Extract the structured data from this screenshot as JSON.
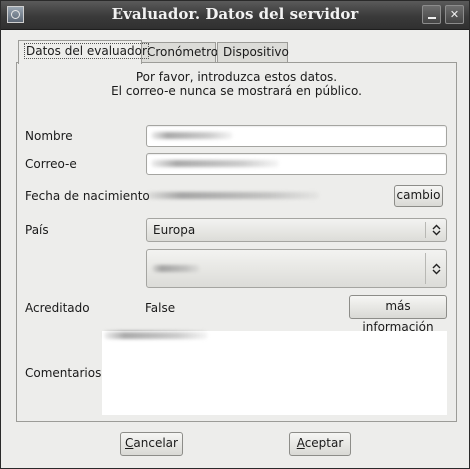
{
  "window": {
    "title": "Evaluador. Datos del servidor",
    "minimize_symbol": "_",
    "close_symbol": "✕"
  },
  "tabs": [
    {
      "label": "Datos del evaluador",
      "active": true
    },
    {
      "label": "Cronómetro",
      "active": false
    },
    {
      "label": "Dispositivo",
      "active": false
    }
  ],
  "intro": {
    "line1": "Por favor, introduzca estos datos.",
    "line2": "El correo-e nunca se mostrará en público."
  },
  "form": {
    "nombre_label": "Nombre",
    "correo_label": "Correo-e",
    "fecha_label": "Fecha de nacimiento",
    "fecha_button": "cambio",
    "pais_label": "País",
    "pais_value": "Europa",
    "acreditado_label": "Acreditado",
    "acreditado_value": "False",
    "info_button": "más información",
    "comentarios_label": "Comentarios"
  },
  "footer": {
    "cancel_first": "C",
    "cancel_rest": "ancelar",
    "accept_first": "A",
    "accept_rest": "ceptar"
  },
  "icons": {
    "app": "app-window-icon",
    "minimize": "minimize-icon",
    "close": "close-icon",
    "combo_arrows": "updown-arrows-icon"
  }
}
